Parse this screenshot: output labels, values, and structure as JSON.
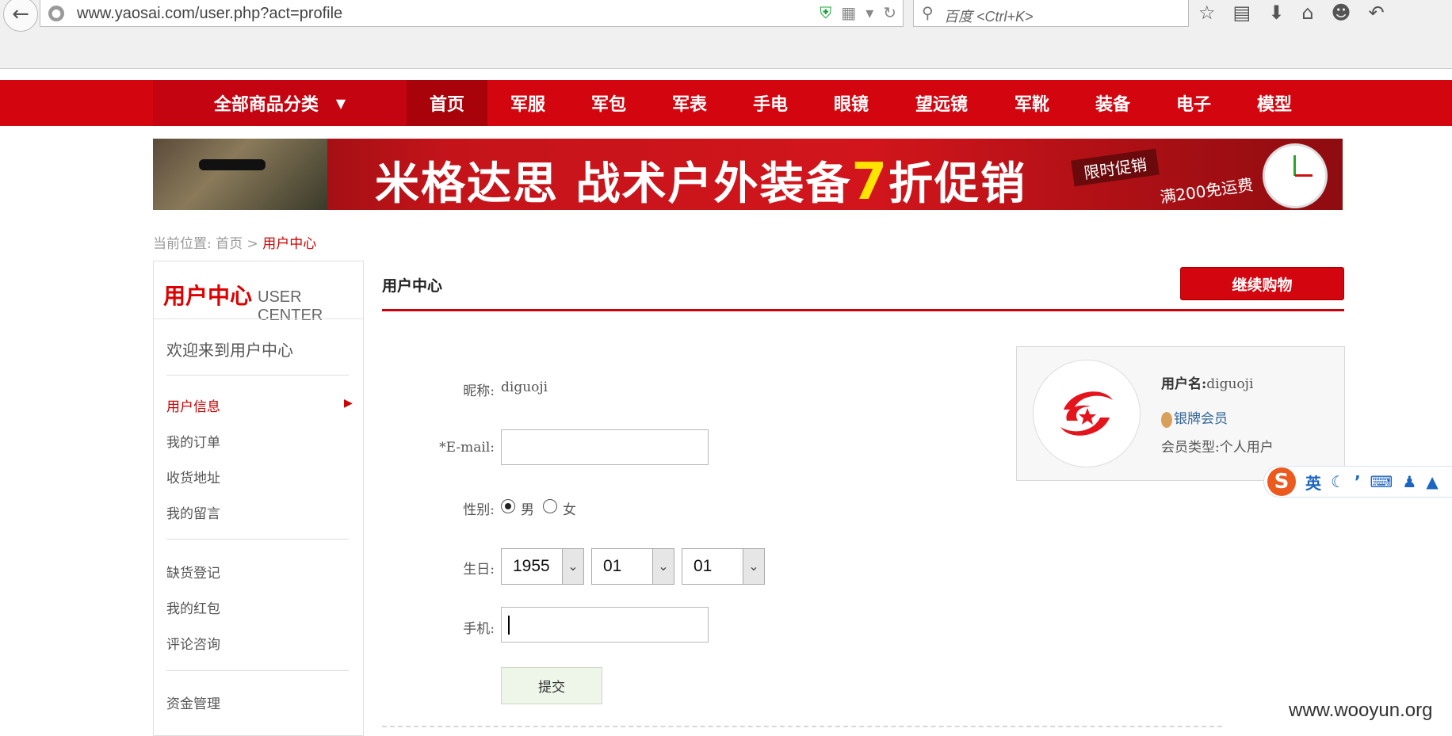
{
  "browser": {
    "url": "www.yaosai.com/user.php?act=profile",
    "search_placeholder": "百度 <Ctrl+K>"
  },
  "nav": {
    "all_categories": "全部商品分类",
    "items": [
      "首页",
      "军服",
      "军包",
      "军表",
      "手电",
      "眼镜",
      "望远镜",
      "军靴",
      "装备",
      "电子",
      "模型"
    ]
  },
  "banner": {
    "main_before": "米格达思 战术户外装备",
    "main_number": "7",
    "main_after": "折促销",
    "tag1": "限时促销",
    "tag2": "满200免运费"
  },
  "breadcrumb": {
    "prefix": "当前位置:",
    "home": "首页",
    "sep": ">",
    "current": "用户中心"
  },
  "sidebar": {
    "title_cn": "用户中心",
    "title_en": "USER CENTER",
    "welcome": "欢迎来到用户中心",
    "group1": [
      "用户信息",
      "我的订单",
      "收货地址",
      "我的留言"
    ],
    "group2": [
      "缺货登记",
      "我的红包",
      "评论咨询"
    ],
    "group3": [
      "资金管理"
    ]
  },
  "main": {
    "title": "用户中心",
    "continue_button": "继续购物"
  },
  "form": {
    "nickname_label": "昵称:",
    "nickname_value": "diguoji",
    "email_label": "*E-mail:",
    "email_value": "",
    "gender_label": "性别:",
    "gender_male": "男",
    "gender_female": "女",
    "gender_selected": "男",
    "birthday_label": "生日:",
    "birth_year": "1955",
    "birth_month": "01",
    "birth_day": "01",
    "phone_label": "手机:",
    "phone_value": "",
    "submit": "提交"
  },
  "user_card": {
    "username_label": "用户名:",
    "username": "diguoji",
    "level": "银牌会员",
    "member_type_label": "会员类型:",
    "member_type": "个人用户"
  },
  "ime": {
    "logo": "S",
    "lang": "英"
  },
  "watermark": "www.wooyun.org",
  "colors": {
    "brand_red": "#d3050f",
    "link_blue": "#336699",
    "submit_bg": "#eef6ea"
  }
}
